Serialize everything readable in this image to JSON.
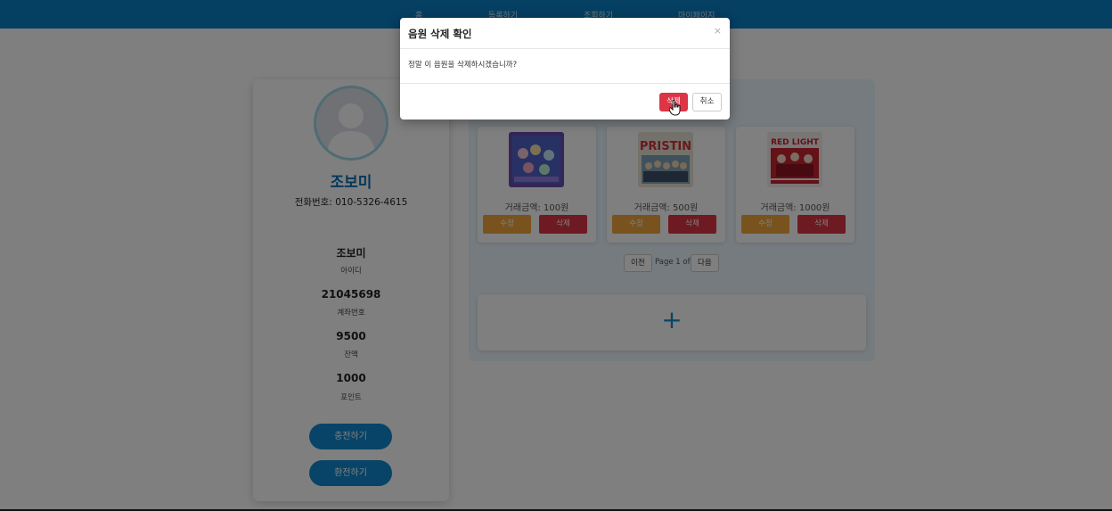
{
  "nav": {
    "items": [
      "홈",
      "등록하기",
      "조회하기",
      "마이페이지"
    ]
  },
  "profile": {
    "name": "조보미",
    "phone": "전화번호: 010-5326-4615",
    "stats": [
      {
        "value": "조보미",
        "label": "아이디"
      },
      {
        "value": "21045698",
        "label": "계좌번호"
      },
      {
        "value": "9500",
        "label": "잔액"
      },
      {
        "value": "1000",
        "label": "포인트"
      }
    ],
    "charge_label": "충전하기",
    "exchange_label": "환전하기"
  },
  "cards": [
    {
      "price": "거래금액: 100원",
      "edit": "수정",
      "delete": "삭제",
      "cover_icon": "album-cover-1"
    },
    {
      "price": "거래금액: 500원",
      "edit": "수정",
      "delete": "삭제",
      "cover_text": "PRISTIN",
      "cover_icon": "album-cover-2"
    },
    {
      "price": "거래금액: 1000원",
      "edit": "수정",
      "delete": "삭제",
      "cover_text": "RED LIGHT",
      "cover_icon": "album-cover-3"
    }
  ],
  "pager": {
    "prev": "이전",
    "text": "Page 1 of",
    "next": "다음"
  },
  "add": {
    "symbol": "+"
  },
  "modal": {
    "title": "음원 삭제 확인",
    "close": "×",
    "message": "정말 이 음원을 삭제하시겠습니까?",
    "confirm": "삭제",
    "cancel": "취소"
  },
  "colors": {
    "primary": "#1189cf",
    "danger": "#dc3545",
    "warning": "#f0a63c",
    "nav": "#0a7fc4"
  }
}
